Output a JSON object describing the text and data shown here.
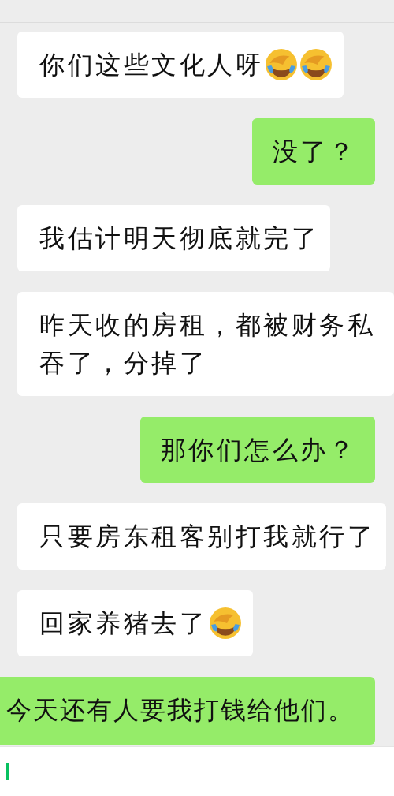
{
  "messages": [
    {
      "kind": "incoming",
      "parts": [
        {
          "kind": "text",
          "text": "你们这些文化人呀"
        },
        {
          "kind": "emoji"
        },
        {
          "kind": "emoji"
        }
      ]
    },
    {
      "kind": "outgoing",
      "parts": [
        {
          "kind": "text",
          "text": "没了？"
        }
      ]
    },
    {
      "kind": "incoming",
      "parts": [
        {
          "kind": "text",
          "text": "我估计明天彻底就完了"
        }
      ]
    },
    {
      "kind": "incoming",
      "parts": [
        {
          "kind": "text",
          "text": "昨天收的房租，都被财务私吞了，分掉了"
        }
      ]
    },
    {
      "kind": "outgoing",
      "parts": [
        {
          "kind": "text",
          "text": "那你们怎么办？"
        }
      ]
    },
    {
      "kind": "incoming",
      "parts": [
        {
          "kind": "text",
          "text": "只要房东租客别打我就行了"
        }
      ]
    },
    {
      "kind": "incoming",
      "parts": [
        {
          "kind": "text",
          "text": "回家养猪去了"
        },
        {
          "kind": "emoji"
        }
      ]
    },
    {
      "kind": "outgoing-wide",
      "parts": [
        {
          "kind": "text",
          "text": "今天还有人要我打钱给他们。"
        }
      ]
    }
  ],
  "input": {
    "focused": true
  }
}
